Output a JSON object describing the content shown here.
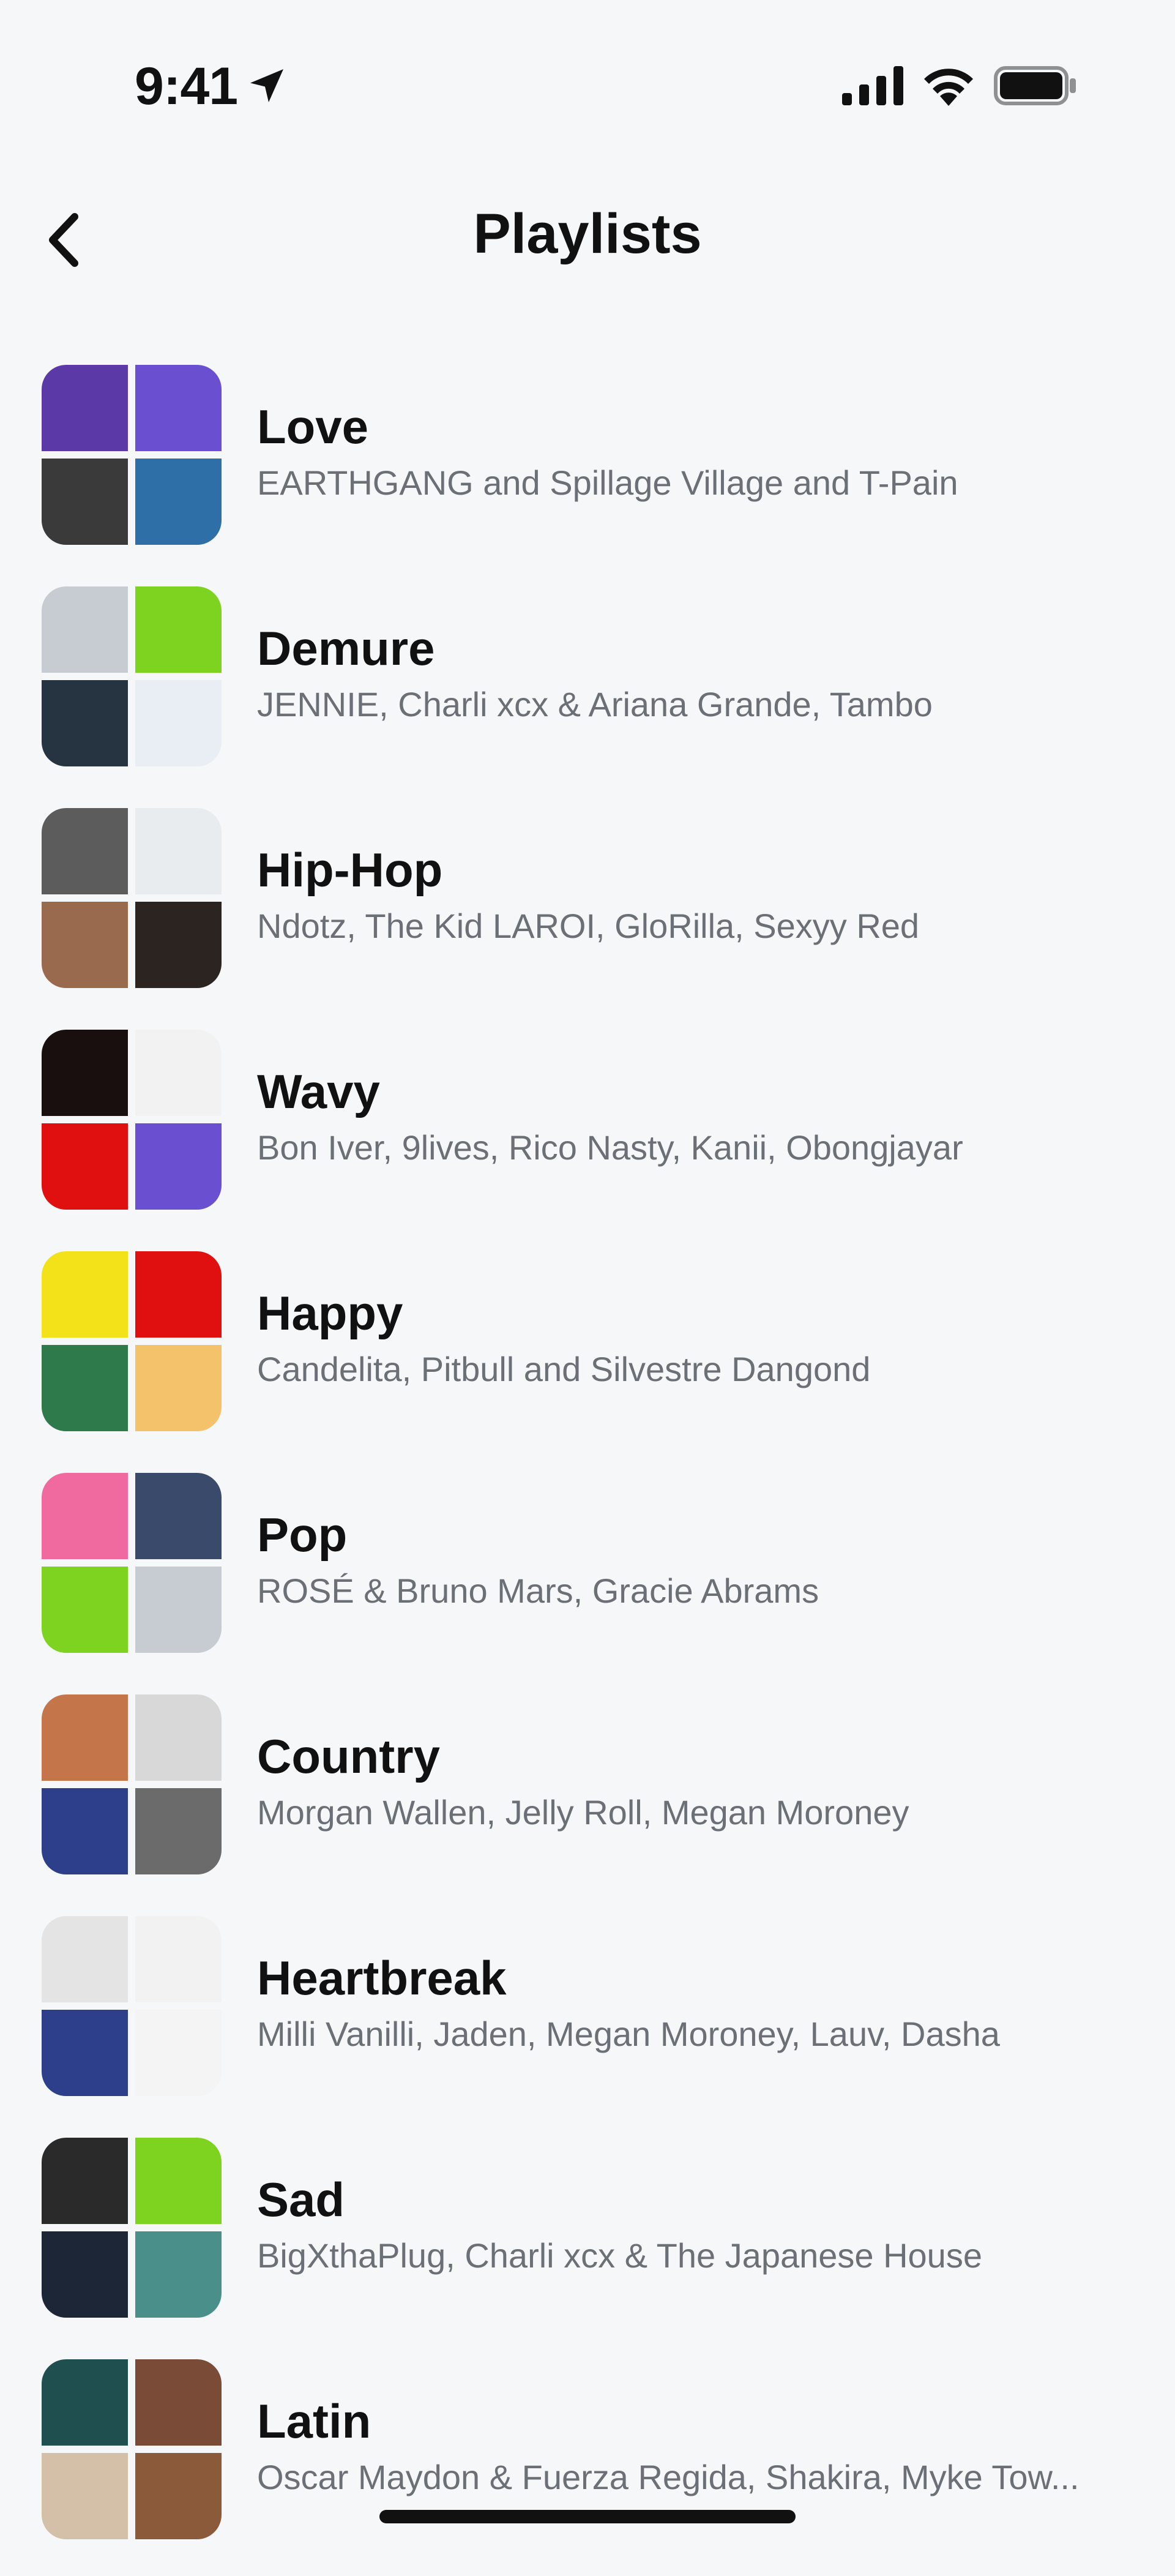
{
  "status_bar": {
    "time": "9:41",
    "icons": [
      "location-arrow-icon",
      "cellular-signal-icon",
      "wifi-icon",
      "battery-icon"
    ]
  },
  "nav": {
    "back_icon": "chevron-left-icon",
    "title": "Playlists"
  },
  "playlists": [
    {
      "title": "Love",
      "subtitle": "EARTHGANG and Spillage Village and T-Pain",
      "tiles": [
        "#5b3aa8",
        "#6b4fd1",
        "#3a3a3a",
        "#2e6fa8"
      ]
    },
    {
      "title": "Demure",
      "subtitle": "JENNIE, Charli xcx & Ariana Grande, Tambo",
      "tiles": [
        "#c7cbd2",
        "#7ed321",
        "#263442",
        "#e9eef4"
      ]
    },
    {
      "title": "Hip-Hop",
      "subtitle": "Ndotz, The Kid LAROI, GloRilla, Sexyy Red",
      "tiles": [
        "#5c5c5c",
        "#e8ecef",
        "#9a6a4e",
        "#2b2420"
      ]
    },
    {
      "title": "Wavy",
      "subtitle": "Bon Iver, 9lives, Rico Nasty, Kanii, Obongjayar",
      "tiles": [
        "#1a0f0f",
        "#f2f2f2",
        "#e01010",
        "#6b4fd1"
      ]
    },
    {
      "title": "Happy",
      "subtitle": "Candelita, Pitbull and Silvestre Dangond",
      "tiles": [
        "#f3e21a",
        "#e01010",
        "#2f7a4b",
        "#f4c26a"
      ]
    },
    {
      "title": "Pop",
      "subtitle": "ROSÉ & Bruno Mars, Gracie Abrams",
      "tiles": [
        "#f06aa0",
        "#3a4a6b",
        "#7ed321",
        "#c7cbd2"
      ]
    },
    {
      "title": "Country",
      "subtitle": "Morgan Wallen, Jelly Roll, Megan Moroney",
      "tiles": [
        "#c4754a",
        "#d8d8d8",
        "#2d3f8a",
        "#6b6b6b"
      ]
    },
    {
      "title": "Heartbreak",
      "subtitle": "Milli Vanilli, Jaden, Megan Moroney, Lauv, Dasha",
      "tiles": [
        "#e4e4e4",
        "#f2f2f2",
        "#2d3f8a",
        "#f4f4f4"
      ]
    },
    {
      "title": "Sad",
      "subtitle": "BigXthaPlug, Charli xcx & The Japanese House",
      "tiles": [
        "#2a2a2a",
        "#7ed321",
        "#1d2636",
        "#4a8f8a"
      ]
    },
    {
      "title": "Latin",
      "subtitle": "Oscar Maydon & Fuerza Regida, Shakira, Myke Tow...",
      "tiles": [
        "#1f4f4f",
        "#7a4b36",
        "#d4c0a8",
        "#8a5a3a"
      ]
    }
  ]
}
